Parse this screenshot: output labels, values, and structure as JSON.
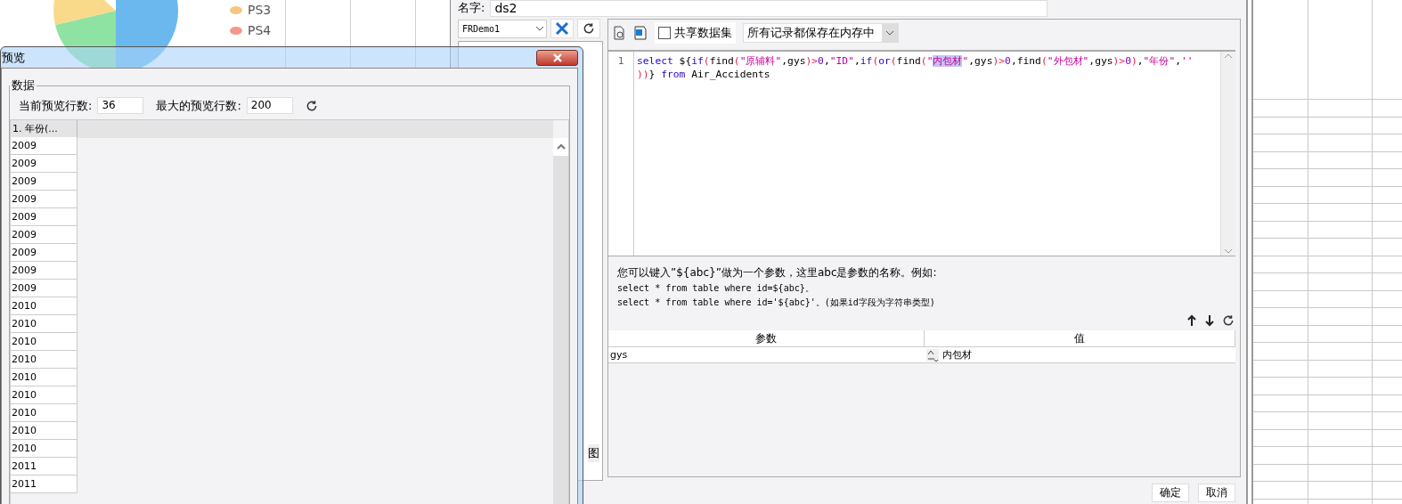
{
  "background_chart": {
    "legend": [
      {
        "label": "PS3",
        "color": "#f5c77e"
      },
      {
        "label": "PS4",
        "color": "#f4998a"
      }
    ]
  },
  "dataset_dialog": {
    "name_label": "名字:",
    "name_value": "ds2",
    "datasource": "FRDemo1",
    "tree_fragment": "图",
    "share_checkbox": {
      "label": "共享数据集",
      "checked": false
    },
    "storage_select": "所有记录都保存在内存中",
    "editor": {
      "line_number": "1",
      "lines": [
        {
          "tokens": [
            {
              "kind": "keyword",
              "text": "select"
            },
            {
              "kind": "plain",
              "text": " ${"
            },
            {
              "kind": "keyword",
              "text": "if"
            },
            {
              "kind": "paren",
              "text": "("
            },
            {
              "kind": "plain",
              "text": "find"
            },
            {
              "kind": "paren",
              "text": "("
            },
            {
              "kind": "string",
              "text": "\"原辅料\""
            },
            {
              "kind": "plain",
              "text": ",gys"
            },
            {
              "kind": "paren",
              "text": ")>"
            },
            {
              "kind": "number",
              "text": "0"
            },
            {
              "kind": "plain",
              "text": ","
            },
            {
              "kind": "string",
              "text": "\"ID\""
            },
            {
              "kind": "plain",
              "text": ","
            },
            {
              "kind": "keyword",
              "text": "if"
            },
            {
              "kind": "paren",
              "text": "("
            },
            {
              "kind": "keyword",
              "text": "or"
            },
            {
              "kind": "paren",
              "text": "("
            },
            {
              "kind": "plain",
              "text": "find"
            },
            {
              "kind": "paren",
              "text": "("
            },
            {
              "kind": "string",
              "text": "\""
            },
            {
              "kind": "selected",
              "text": "内包材"
            },
            {
              "kind": "string",
              "text": "\""
            },
            {
              "kind": "plain",
              "text": ",gys"
            },
            {
              "kind": "paren",
              "text": ")>"
            },
            {
              "kind": "number",
              "text": "0"
            },
            {
              "kind": "plain",
              "text": ",find"
            },
            {
              "kind": "paren",
              "text": "("
            },
            {
              "kind": "string",
              "text": "\"外包材\""
            },
            {
              "kind": "plain",
              "text": ",gys"
            },
            {
              "kind": "paren",
              "text": ")>"
            },
            {
              "kind": "number",
              "text": "0"
            },
            {
              "kind": "paren",
              "text": ")"
            },
            {
              "kind": "plain",
              "text": ","
            },
            {
              "kind": "string",
              "text": "\"年份\""
            },
            {
              "kind": "plain",
              "text": ","
            },
            {
              "kind": "string",
              "text": "''"
            }
          ]
        },
        {
          "tokens": [
            {
              "kind": "paren",
              "text": "))"
            },
            {
              "kind": "plain",
              "text": "} "
            },
            {
              "kind": "keyword",
              "text": "from"
            },
            {
              "kind": "plain",
              "text": " Air_Accidents"
            }
          ]
        }
      ]
    },
    "hint": [
      "您可以键入”${abc}”做为一个参数，这里abc是参数的名称。例如:",
      "select * from table where id=${abc}。",
      "select * from table where id='${abc}'。(如果id字段为字符串类型)"
    ],
    "params": {
      "columns": [
        "参数",
        "值"
      ],
      "rows": [
        {
          "name": "gys",
          "value": "内包材"
        }
      ]
    },
    "buttons": [
      "确定",
      "取消"
    ]
  },
  "preview_window": {
    "title": "预览",
    "group_title": "数据",
    "current_rows_label": "当前预览行数:",
    "current_rows": "36",
    "max_rows_label": "最大的预览行数:",
    "max_rows": "200",
    "table": {
      "columns": [
        "1. 年份(..."
      ],
      "rows": [
        "2009",
        "2009",
        "2009",
        "2009",
        "2009",
        "2009",
        "2009",
        "2009",
        "2009",
        "2010",
        "2010",
        "2010",
        "2010",
        "2010",
        "2010",
        "2010",
        "2010",
        "2010",
        "2011",
        "2011"
      ]
    }
  }
}
